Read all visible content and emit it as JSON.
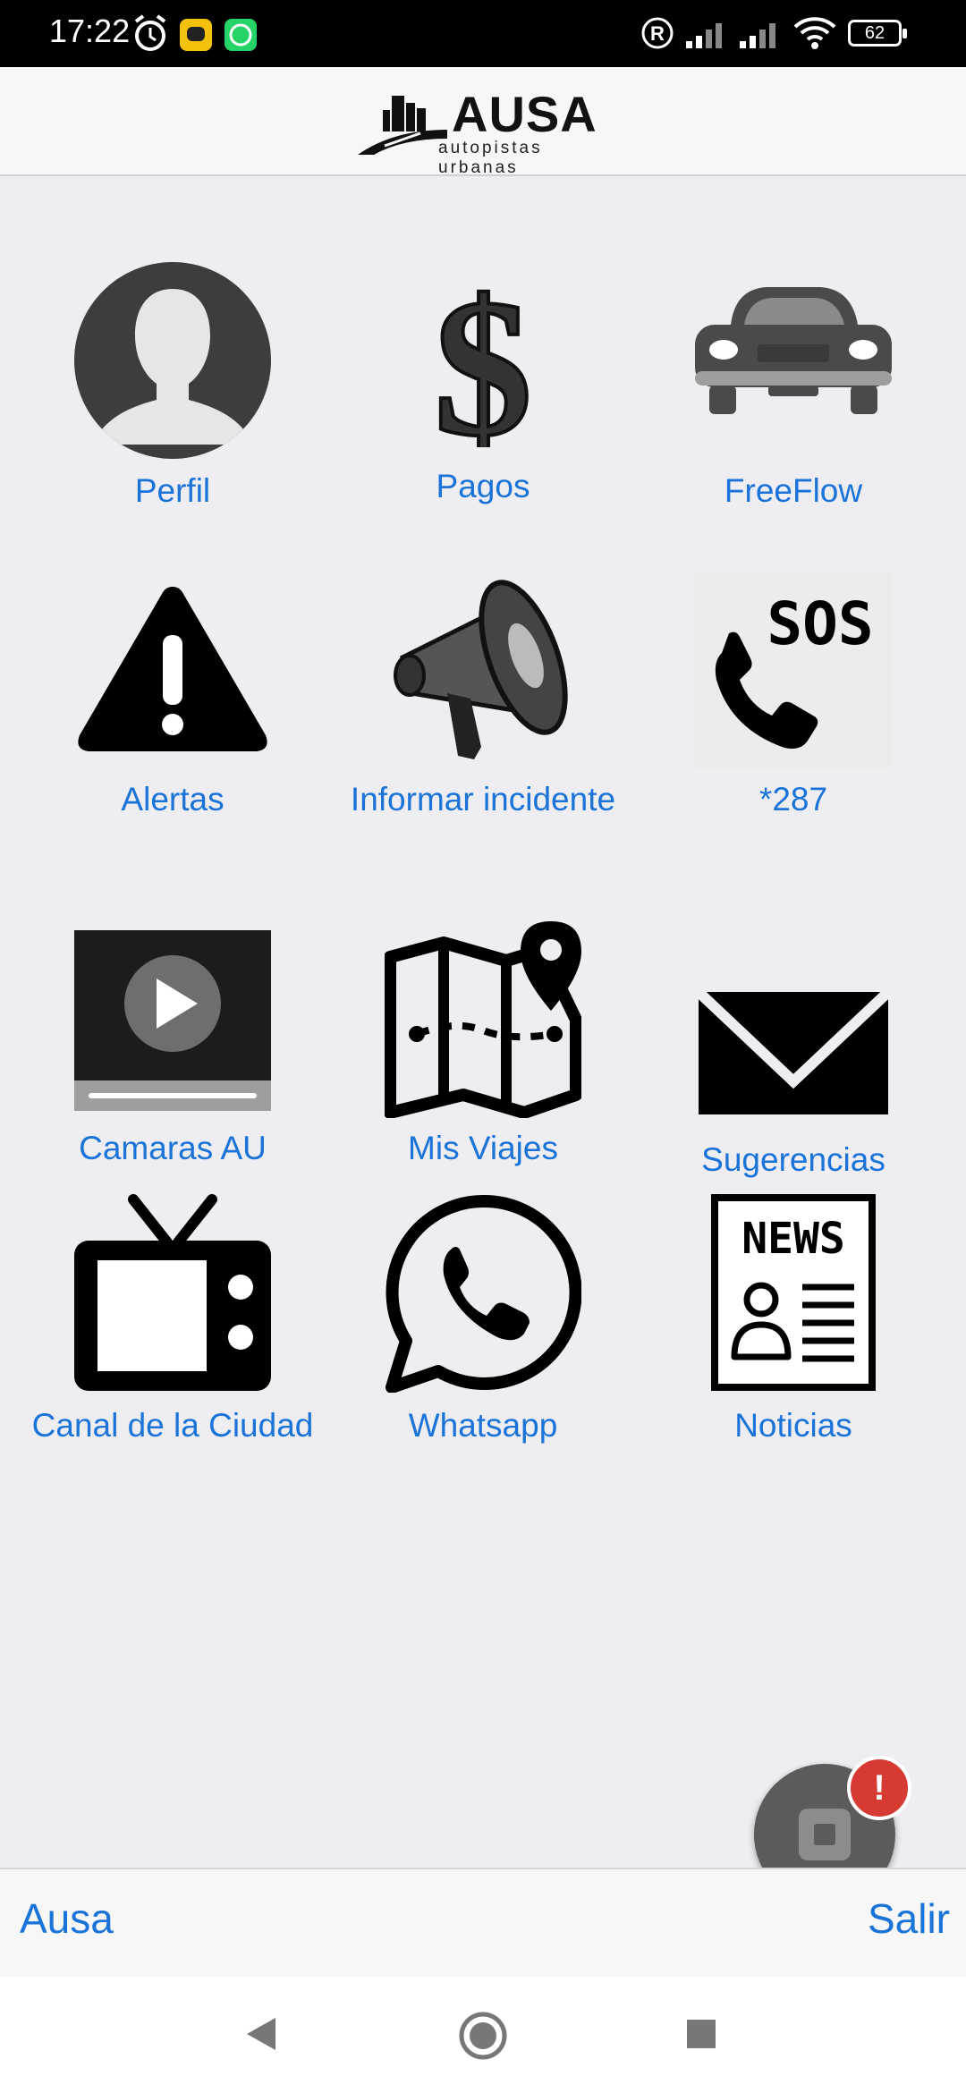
{
  "status_bar": {
    "time": "17:22",
    "battery": "62",
    "icons": [
      "alarm-icon",
      "app-notification-icon",
      "whatsapp-notification-icon",
      "registered-icon",
      "signal-icon",
      "signal-icon",
      "wifi-icon",
      "battery-icon"
    ]
  },
  "header": {
    "logo_title": "AUSA",
    "logo_subtitle": "autopistas urbanas"
  },
  "menu": [
    {
      "label": "Perfil",
      "icon": "profile-icon"
    },
    {
      "label": "Pagos",
      "icon": "dollar-icon"
    },
    {
      "label": "FreeFlow",
      "icon": "car-icon"
    },
    {
      "label": "Alertas",
      "icon": "warning-icon"
    },
    {
      "label": "Informar incidente",
      "icon": "megaphone-icon"
    },
    {
      "label": "*287",
      "icon": "sos-phone-icon"
    },
    {
      "label": "Camaras AU",
      "icon": "video-icon"
    },
    {
      "label": "Mis Viajes",
      "icon": "map-icon"
    },
    {
      "label": "Sugerencias",
      "icon": "mail-icon"
    },
    {
      "label": "Canal de la Ciudad",
      "icon": "tv-icon"
    },
    {
      "label": "Whatsapp",
      "icon": "whatsapp-icon"
    },
    {
      "label": "Noticias",
      "icon": "news-icon"
    }
  ],
  "sos_text": "SOS",
  "news_text": "NEWS",
  "fab": {
    "badge": "!"
  },
  "footer": {
    "left_link": "Ausa",
    "right_link": "Salir"
  },
  "colors": {
    "link": "#1a73d8",
    "background": "#ededf2",
    "badge": "#d63a32"
  }
}
